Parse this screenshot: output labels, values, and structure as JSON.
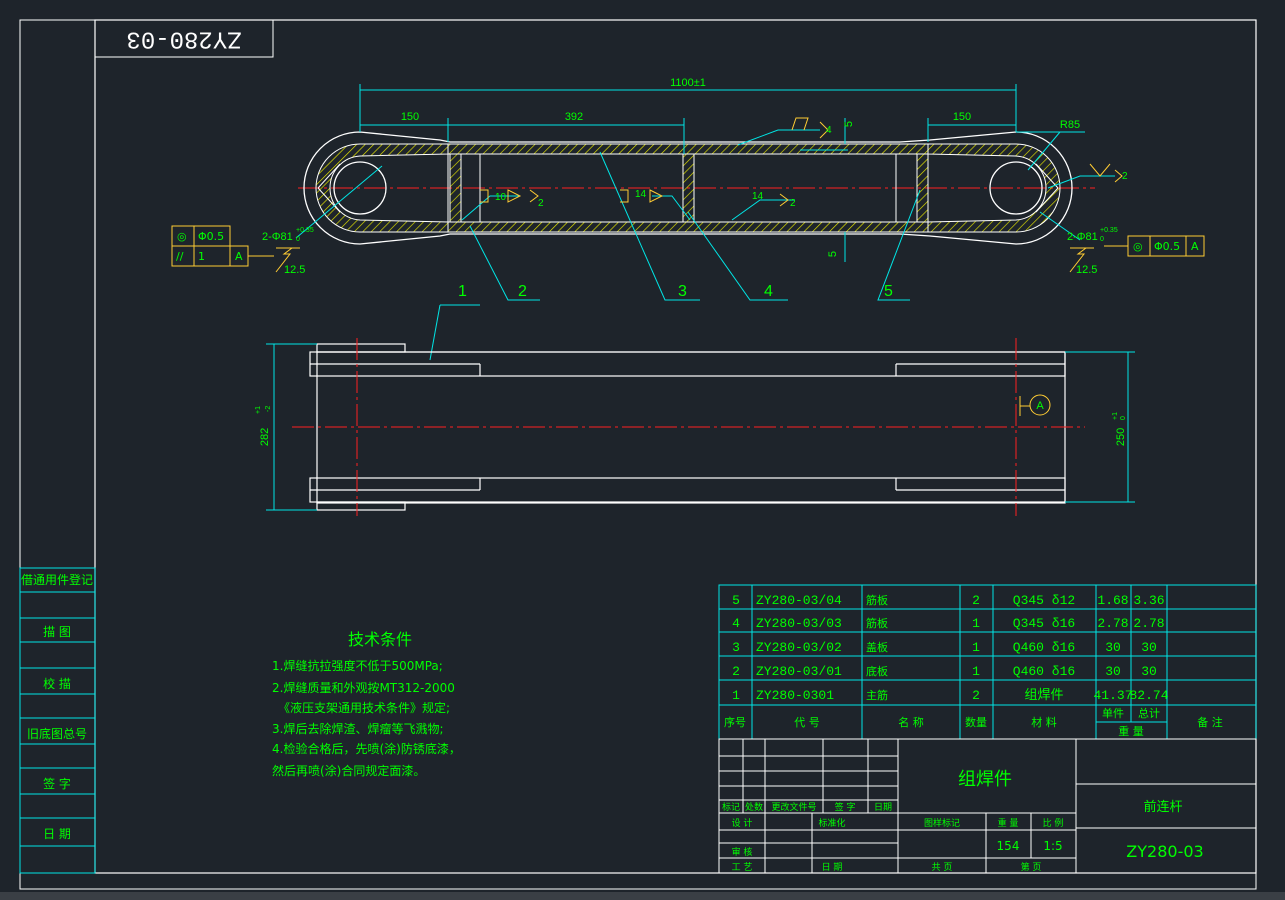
{
  "colors": {
    "background": "#1e242b",
    "frame": "#ffffff",
    "table": "#00e5e5",
    "text": "#00ff00",
    "dim_text": "#00ff00",
    "centerline": "#ff2020",
    "hatch": "#e6e600",
    "leader": "#00e5e5",
    "annot": "#ffcc33",
    "weld_sym": "#cc66ff"
  },
  "drawing_number_mirrored": "ZY280-03",
  "dimensions": {
    "overall": "1100±1",
    "left_end": "150",
    "mid": "392",
    "right_end": "150",
    "radius": "R85",
    "plate_top": "5",
    "plate_bottom": "5",
    "height_front": "282",
    "height_front_tol_upper": "+1",
    "height_front_tol_lower": "-2",
    "height_inner": "250",
    "height_inner_tol_upper": "+1",
    "height_inner_tol_lower": "0",
    "hole_left": "2-Φ81",
    "hole_right": "2-Φ81",
    "hole_tol_upper": "+0.35",
    "hole_tol_lower": "0",
    "roughness_left": "12.5",
    "roughness_right": "12.5"
  },
  "weld_symbols": {
    "top": "4",
    "right": "2",
    "left_size": "10",
    "left_count": "2",
    "mid_size": "14",
    "center_size": "14",
    "center_count": "2"
  },
  "gdt": {
    "left_row1_symbol": "◎",
    "left_row1_value": "Φ0.5",
    "left_row2_symbol": "//",
    "left_row2_value": "1",
    "left_row2_datum": "A",
    "right_symbol": "◎",
    "right_value": "Φ0.5",
    "right_datum": "A",
    "datum_label": "A"
  },
  "balloons": [
    "1",
    "2",
    "3",
    "4",
    "5"
  ],
  "side_box": [
    "借通用件登记",
    "描 图",
    "校 描",
    "旧底图总号",
    "签 字",
    "日 期"
  ],
  "tech_title": "技术条件",
  "tech_lines": [
    "1.焊缝抗拉强度不低于500MPa;",
    "2.焊缝质量和外观按MT312-2000",
    "《液压支架通用技术条件》规定;",
    "3.焊后去除焊渣、焊瘤等飞溅物;",
    "4.检验合格后，先喷(涂)防锈底漆，",
    "  然后再喷(涂)合同规定面漆。"
  ],
  "bom_rows": [
    {
      "no": "5",
      "code": "ZY280-03/04",
      "name": "筋板",
      "qty": "2",
      "material": "Q345 δ12",
      "unit": "1.68",
      "total": "3.36",
      "note": ""
    },
    {
      "no": "4",
      "code": "ZY280-03/03",
      "name": "筋板",
      "qty": "1",
      "material": "Q345 δ16",
      "unit": "2.78",
      "total": "2.78",
      "note": ""
    },
    {
      "no": "3",
      "code": "ZY280-03/02",
      "name": "盖板",
      "qty": "1",
      "material": "Q460 δ16",
      "unit": "30",
      "total": "30",
      "note": ""
    },
    {
      "no": "2",
      "code": "ZY280-03/01",
      "name": "底板",
      "qty": "1",
      "material": "Q460 δ16",
      "unit": "30",
      "total": "30",
      "note": ""
    },
    {
      "no": "1",
      "code": "ZY280-0301",
      "name": "主筋",
      "qty": "2",
      "material": "组焊件",
      "unit": "41.37",
      "total": "82.74",
      "note": ""
    }
  ],
  "bom_header": {
    "no": "序号",
    "code": "代 号",
    "name": "名 称",
    "qty": "数量",
    "material": "材 料",
    "unit": "单件",
    "total": "总计",
    "weight": "重 量",
    "note": "备 注"
  },
  "title_block": {
    "type_label": "组焊件",
    "part_name": "前连杆",
    "drawing_no": "ZY280-03",
    "rev_mark": "标记",
    "rev_count": "处数",
    "rev_doc": "更改文件号",
    "rev_sign": "签 字",
    "rev_date": "日期",
    "design": "设 计",
    "standard": "标准化",
    "review": "审 核",
    "process": "工 艺",
    "date": "日 期",
    "stage_label": "图样标记",
    "weight_label": "重 量",
    "scale_label": "比 例",
    "weight": "154",
    "scale": "1:5",
    "sheets": "共  页",
    "sheet": "第  页"
  }
}
